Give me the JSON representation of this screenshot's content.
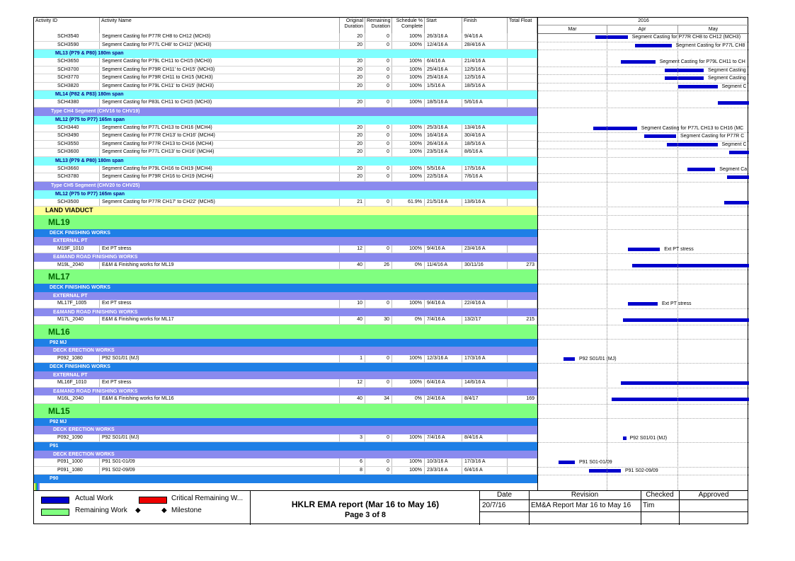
{
  "header": {
    "activity_id": "Activity ID",
    "activity_name": "Activity Name",
    "original_duration": "Original Duration",
    "remaining_duration": "Remaining Duration",
    "schedule_pct": "Schedule % Complete",
    "start": "Start",
    "finish": "Finish",
    "total_float": "Total Float"
  },
  "timeline": {
    "year": "2016",
    "months": [
      "Mar",
      "Apr",
      "May"
    ]
  },
  "rows": [
    {
      "type": "task",
      "id": "SCH3540",
      "name": "Segment Casting for P77R CH8 to CH12 (MCH3)",
      "od": "20",
      "rd": "0",
      "pct": "100%",
      "start": "26/3/16 A",
      "finish": "9/4/16 A",
      "tf": "",
      "bar": {
        "s": "26/3",
        "f": "9/4"
      },
      "label": "Segment Casting for P77R CH8 to CH12 (MCH3)"
    },
    {
      "type": "task",
      "id": "SCH3590",
      "name": "Segment Casting for P77L CH8' to CH12' (MCH3)",
      "od": "20",
      "rd": "0",
      "pct": "100%",
      "start": "12/4/16 A",
      "finish": "28/4/16 A",
      "tf": "",
      "bar": {
        "s": "12/4",
        "f": "28/4"
      },
      "label": "Segment Casting for P77L CH8"
    },
    {
      "type": "wbs-c",
      "title": "ML13 (P79 & P80) 180m span"
    },
    {
      "type": "task",
      "id": "SCH3650",
      "name": "Segment Casting for P79L CH11 to CH15 (MCH3)",
      "od": "20",
      "rd": "0",
      "pct": "100%",
      "start": "6/4/16 A",
      "finish": "21/4/16 A",
      "tf": "",
      "bar": {
        "s": "6/4",
        "f": "21/4"
      },
      "label": "Segment Casting for P79L CH11 to CH"
    },
    {
      "type": "task",
      "id": "SCH3700",
      "name": "Segment Casting for P79R CH11' to CH15' (MCH3)",
      "od": "20",
      "rd": "0",
      "pct": "100%",
      "start": "25/4/16 A",
      "finish": "12/5/16 A",
      "tf": "",
      "bar": {
        "s": "25/4",
        "f": "12/5"
      },
      "label": "Segment Casting"
    },
    {
      "type": "task",
      "id": "SCH3770",
      "name": "Segment Casting for P79R CH11 to CH15 (MCH3)",
      "od": "20",
      "rd": "0",
      "pct": "100%",
      "start": "25/4/16 A",
      "finish": "12/5/16 A",
      "tf": "",
      "bar": {
        "s": "25/4",
        "f": "12/5"
      },
      "label": "Segment Casting"
    },
    {
      "type": "task",
      "id": "SCH3820",
      "name": "Segment Casting for P79L CH11' to CH15' (MCH3)",
      "od": "20",
      "rd": "0",
      "pct": "100%",
      "start": "1/5/16 A",
      "finish": "18/5/16 A",
      "tf": "",
      "bar": {
        "s": "1/5",
        "f": "18/5"
      },
      "label": "Segment C"
    },
    {
      "type": "wbs-c",
      "title": "ML14 (P82 & P83) 180m span"
    },
    {
      "type": "task",
      "id": "SCH4380",
      "name": "Segment Casting for P83L CH11 to CH15 (MCH3)",
      "od": "20",
      "rd": "0",
      "pct": "100%",
      "start": "18/5/16 A",
      "finish": "5/6/16 A",
      "tf": "",
      "bar": {
        "s": "18/5",
        "f": "5/6"
      },
      "label": ""
    },
    {
      "type": "wbs-p2",
      "title": "Type CH4 Segment (CHV16 to CHV19)"
    },
    {
      "type": "wbs-c",
      "title": "ML12 (P75 to P77) 165m span"
    },
    {
      "type": "task",
      "id": "SCH3440",
      "name": "Segment Casting for P77L CH13 to CH16 (MCH4)",
      "od": "20",
      "rd": "0",
      "pct": "100%",
      "start": "25/3/16 A",
      "finish": "13/4/16 A",
      "tf": "",
      "bar": {
        "s": "25/3",
        "f": "13/4"
      },
      "label": "Segment Casting for P77L CH13 to CH16 (MC"
    },
    {
      "type": "task",
      "id": "SCH3490",
      "name": "Segment Casting for P77R CH13' to CH16' (MCH4)",
      "od": "20",
      "rd": "0",
      "pct": "100%",
      "start": "16/4/16 A",
      "finish": "30/4/16 A",
      "tf": "",
      "bar": {
        "s": "16/4",
        "f": "30/4"
      },
      "label": "Segment Casting for P77R C"
    },
    {
      "type": "task",
      "id": "SCH3550",
      "name": "Segment Casting for P77R CH13 to CH16 (MCH4)",
      "od": "20",
      "rd": "0",
      "pct": "100%",
      "start": "26/4/16 A",
      "finish": "18/5/16 A",
      "tf": "",
      "bar": {
        "s": "26/4",
        "f": "18/5"
      },
      "label": "Segment C"
    },
    {
      "type": "task",
      "id": "SCH3600",
      "name": "Segment Casting for P77L CH13' to CH16' (MCH4)",
      "od": "20",
      "rd": "0",
      "pct": "100%",
      "start": "23/5/16 A",
      "finish": "8/6/16 A",
      "tf": "",
      "bar": {
        "s": "23/5",
        "f": "8/6"
      },
      "label": ""
    },
    {
      "type": "wbs-c",
      "title": "ML13 (P79 & P80) 180m span"
    },
    {
      "type": "task",
      "id": "SCH3660",
      "name": "Segment Casting for P79L CH16 to CH19 (MCH4)",
      "od": "20",
      "rd": "0",
      "pct": "100%",
      "start": "5/5/16 A",
      "finish": "17/5/16 A",
      "tf": "",
      "bar": {
        "s": "5/5",
        "f": "17/5"
      },
      "label": "Segment Ca"
    },
    {
      "type": "task",
      "id": "SCH3780",
      "name": "Segment Casting for P79R CH16 to CH19 (MCH4)",
      "od": "20",
      "rd": "0",
      "pct": "100%",
      "start": "22/5/16 A",
      "finish": "7/6/16 A",
      "tf": "",
      "bar": {
        "s": "22/5",
        "f": "7/6"
      },
      "label": ""
    },
    {
      "type": "wbs-p2",
      "title": "Type CH5 Segment (CHV20 to CHV25)"
    },
    {
      "type": "wbs-c",
      "title": "ML12 (P75 to P77) 165m span"
    },
    {
      "type": "task",
      "id": "SCH3500",
      "name": "Segment Casting for P77R CH17' to CH22' (MCH5)",
      "od": "21",
      "rd": "0",
      "pct": "61.9%",
      "start": "21/5/16 A",
      "finish": "13/6/16 A",
      "tf": "",
      "bar": {
        "s": "21/5",
        "f": "13/6"
      },
      "label": ""
    },
    {
      "type": "proj",
      "title": "LAND VIADUCT"
    },
    {
      "type": "big",
      "title": "ML19"
    },
    {
      "type": "wbs-b",
      "title": "DECK FINISHING WORKS"
    },
    {
      "type": "wbs-p",
      "title": "EXTERNAL PT"
    },
    {
      "type": "task",
      "id": "M19F_1010",
      "name": "Ext PT stress",
      "od": "12",
      "rd": "0",
      "pct": "100%",
      "start": "9/4/16 A",
      "finish": "23/4/16 A",
      "tf": "",
      "bar": {
        "s": "9/4",
        "f": "23/4"
      },
      "label": "Ext PT stress"
    },
    {
      "type": "wbs-p",
      "title": "E&MAND ROAD FINISHING WORKS"
    },
    {
      "type": "task",
      "id": "M19L_2040",
      "name": "E&M & Finishing works for ML19",
      "od": "40",
      "rd": "26",
      "pct": "0%",
      "start": "11/4/16 A",
      "finish": "30/11/16",
      "tf": "273",
      "bar": {
        "s": "11/4",
        "f": "end"
      },
      "label": ""
    },
    {
      "type": "big",
      "title": "ML17"
    },
    {
      "type": "wbs-b",
      "title": "DECK FINISHING WORKS"
    },
    {
      "type": "wbs-p",
      "title": "EXTERNAL PT"
    },
    {
      "type": "task",
      "id": "ML17F_1005",
      "name": "Ext PT stress",
      "od": "10",
      "rd": "0",
      "pct": "100%",
      "start": "9/4/16 A",
      "finish": "22/4/16 A",
      "tf": "",
      "bar": {
        "s": "9/4",
        "f": "22/4"
      },
      "label": "Ext PT stress"
    },
    {
      "type": "wbs-p",
      "title": "E&MAND ROAD FINISHING WORKS"
    },
    {
      "type": "task",
      "id": "M17L_2040",
      "name": "E&M & Finishing works for ML17",
      "od": "40",
      "rd": "30",
      "pct": "0%",
      "start": "7/4/16 A",
      "finish": "13/2/17",
      "tf": "215",
      "bar": {
        "s": "7/4",
        "f": "end"
      },
      "label": ""
    },
    {
      "type": "big",
      "title": "ML16"
    },
    {
      "type": "wbs-b",
      "title": "P92 MJ"
    },
    {
      "type": "wbs-p",
      "title": "DECK ERECTION WORKS"
    },
    {
      "type": "task",
      "id": "P092_1080",
      "name": "P92 S01/01 (MJ)",
      "od": "1",
      "rd": "0",
      "pct": "100%",
      "start": "12/3/16 A",
      "finish": "17/3/16 A",
      "tf": "",
      "bar": {
        "s": "12/3",
        "f": "17/3"
      },
      "label": "P92 S01/01 (MJ)"
    },
    {
      "type": "wbs-b",
      "title": "DECK FINISHING WORKS"
    },
    {
      "type": "wbs-p",
      "title": "EXTERNAL PT"
    },
    {
      "type": "task",
      "id": "ML16F_1010",
      "name": "Ext PT stress",
      "od": "12",
      "rd": "0",
      "pct": "100%",
      "start": "6/4/16 A",
      "finish": "14/6/16 A",
      "tf": "",
      "bar": {
        "s": "6/4",
        "f": "end"
      },
      "label": ""
    },
    {
      "type": "wbs-p",
      "title": "E&MAND ROAD FINISHING WORKS"
    },
    {
      "type": "task",
      "id": "M16L_2040",
      "name": "E&M & Finishing works for ML16",
      "od": "40",
      "rd": "34",
      "pct": "0%",
      "start": "2/4/16 A",
      "finish": "8/4/17",
      "tf": "169",
      "bar": {
        "s": "2/4",
        "f": "end"
      },
      "label": ""
    },
    {
      "type": "big",
      "title": "ML15"
    },
    {
      "type": "wbs-b",
      "title": "P92 MJ"
    },
    {
      "type": "wbs-p",
      "title": "DECK ERECTION WORKS"
    },
    {
      "type": "task",
      "id": "P092_1090",
      "name": "P92 S01/01 (MJ)",
      "od": "3",
      "rd": "0",
      "pct": "100%",
      "start": "7/4/16 A",
      "finish": "8/4/16 A",
      "tf": "",
      "bar": {
        "s": "7/4",
        "f": "8/4"
      },
      "label": "P92 S01/01 (MJ)"
    },
    {
      "type": "wbs-b",
      "title": "P91"
    },
    {
      "type": "wbs-p",
      "title": "DECK ERECTION WORKS"
    },
    {
      "type": "task",
      "id": "P091_1000",
      "name": "P91 S01-01/09",
      "od": "6",
      "rd": "0",
      "pct": "100%",
      "start": "10/3/16 A",
      "finish": "17/3/16 A",
      "tf": "",
      "bar": {
        "s": "10/3",
        "f": "17/3"
      },
      "label": "P91 S01-01/09"
    },
    {
      "type": "task",
      "id": "P091_1080",
      "name": "P91 S02-09/09",
      "od": "8",
      "rd": "0",
      "pct": "100%",
      "start": "23/3/16 A",
      "finish": "6/4/16 A",
      "tf": "",
      "bar": {
        "s": "23/3",
        "f": "6/4"
      },
      "label": "P91 S02-09/09"
    },
    {
      "type": "wbs-b",
      "title": "P90"
    }
  ],
  "legend": {
    "actual_work": "Actual Work",
    "critical_remaining": "Critical Remaining W...",
    "remaining_work": "Remaining Work",
    "milestone": "Milestone",
    "milestone_glyph": "◆"
  },
  "report": {
    "title": "HKLR EMA report (Mar 16 to May 16)",
    "page": "Page 3 of 8"
  },
  "revision_table": {
    "date_h": "Date",
    "revision_h": "Revision",
    "checked_h": "Checked",
    "approved_h": "Approved",
    "date": "20/7/16",
    "revision": "EM&A Report Mar 16 to May 16",
    "checked": "Tim",
    "approved": ""
  },
  "colors": {
    "actual": "#0000cc",
    "critical": "#ee0000",
    "remaining": "#80ff80",
    "wbs_blue": "#1e7fe6",
    "wbs_purple": "#8a8aee",
    "wbs_cyan": "#80ffff",
    "project": "#ffff99"
  }
}
